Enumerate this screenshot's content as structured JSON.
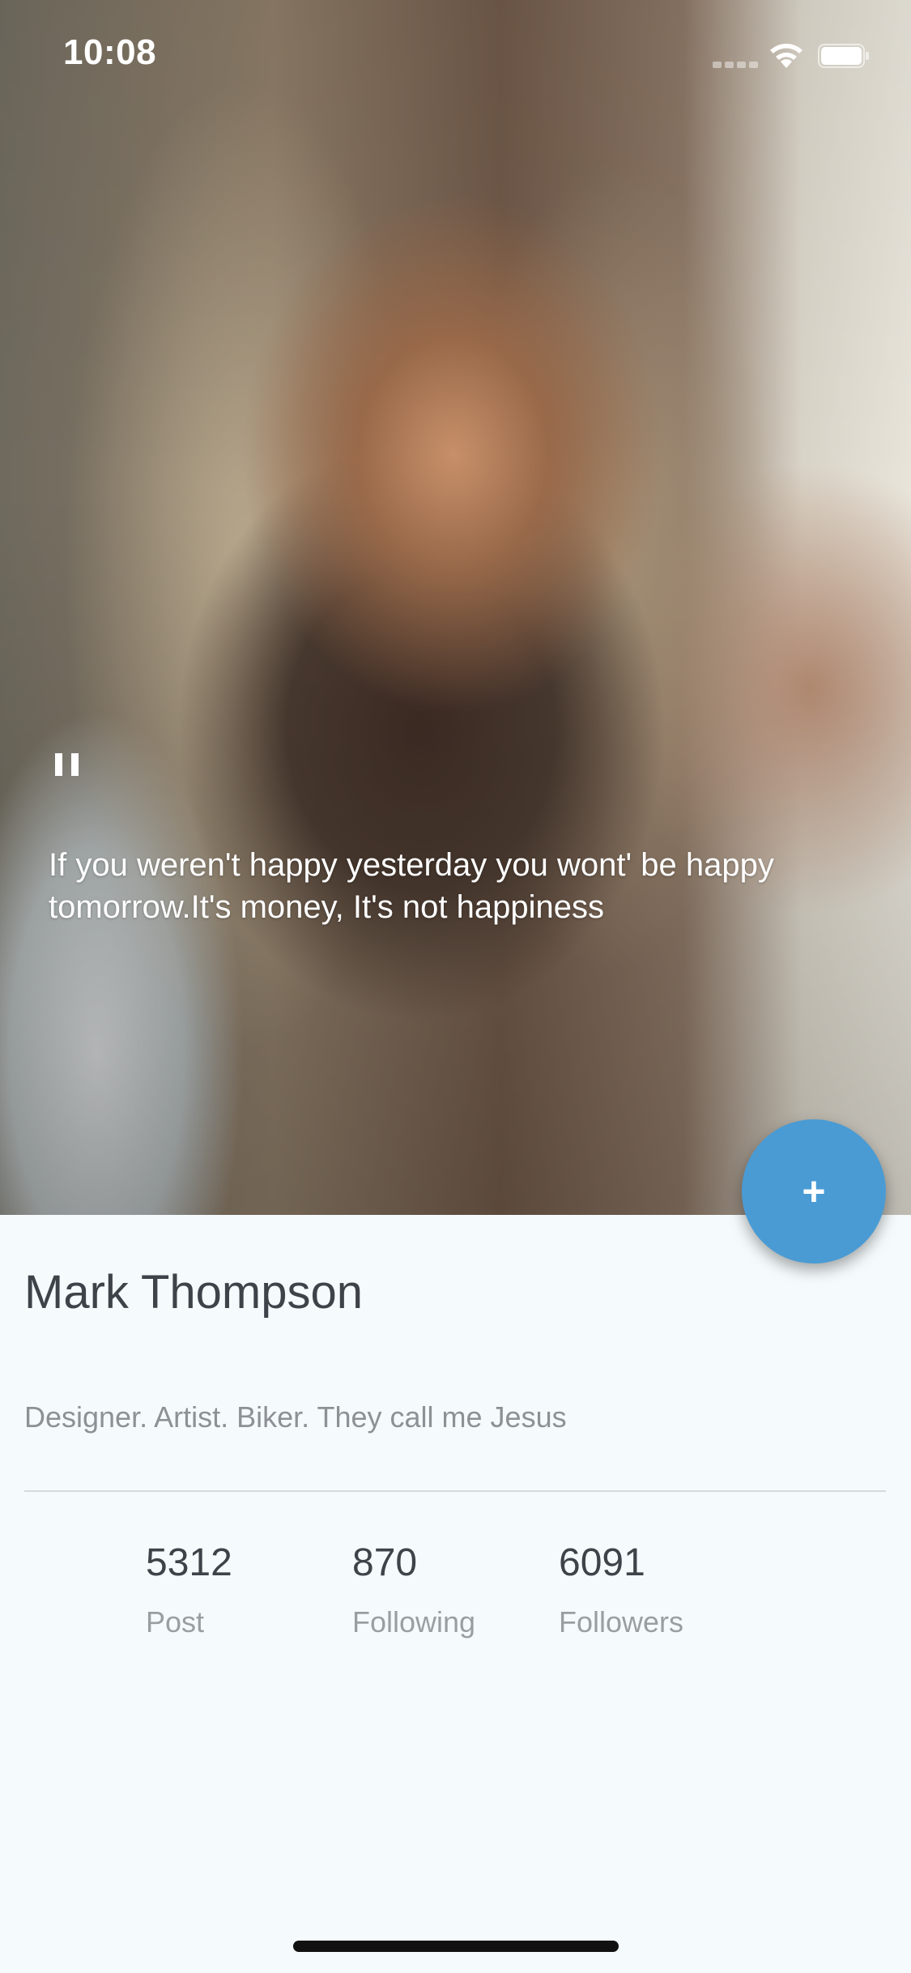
{
  "status_bar": {
    "time": "10:08"
  },
  "hero": {
    "image_icon": "profile-photo",
    "quote_mark": "\"",
    "quote": "If you weren't happy yesterday you wont' be happy tomorrow.It's money, It's not happiness"
  },
  "fab": {
    "icon": "plus-icon",
    "label": "+"
  },
  "profile": {
    "name": "Mark Thompson",
    "bio": "Designer. Artist. Biker. They call me Jesus"
  },
  "stats": [
    {
      "value": "5312",
      "label": "Post"
    },
    {
      "value": "870",
      "label": "Following"
    },
    {
      "value": "6091",
      "label": "Followers"
    }
  ],
  "colors": {
    "accent": "#4a9bd4",
    "background": "#f5fbfd",
    "name_text": "#3e4249",
    "secondary_text": "#8d9196"
  }
}
